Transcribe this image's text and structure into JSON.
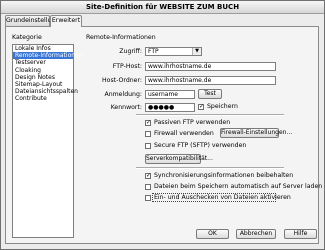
{
  "window": {
    "title": "Site-Definition für WEBSITE ZUM BUCH"
  },
  "tabs": [
    {
      "label": "Grundeinstellungen",
      "active": false
    },
    {
      "label": "Erweitert",
      "active": true
    }
  ],
  "category": {
    "heading": "Kategorie",
    "items": [
      {
        "label": "Lokale Infos",
        "selected": false
      },
      {
        "label": "Remote-Informationen",
        "selected": true
      },
      {
        "label": "Testserver",
        "selected": false
      },
      {
        "label": "Cloaking",
        "selected": false
      },
      {
        "label": "Design Notes",
        "selected": false
      },
      {
        "label": "Sitemap-Layout",
        "selected": false
      },
      {
        "label": "Dateiansichtsspalten",
        "selected": false
      },
      {
        "label": "Contribute",
        "selected": false
      }
    ]
  },
  "remote": {
    "heading": "Remote-Informationen",
    "access_label": "Zugriff:",
    "access_value": "FTP",
    "ftp_host_label": "FTP-Host:",
    "ftp_host_value": "www.ihrhostname.de",
    "host_folder_label": "Host-Ordner:",
    "host_folder_value": "www.ihrhostname.de",
    "login_label": "Anmeldung:",
    "login_value": "username",
    "test_button": "Test",
    "password_label": "Kennwort:",
    "password_value": "●●●●●",
    "save_label": "Speichern",
    "save_checked": true,
    "passive_ftp_label": "Passiven FTP verwenden",
    "passive_ftp_checked": true,
    "firewall_label": "Firewall verwenden",
    "firewall_checked": false,
    "firewall_settings_button": "Firewall-Einstellungen...",
    "secure_ftp_label": "Secure FTP (SFTP) verwenden",
    "secure_ftp_checked": false,
    "server_compat_button": "Serverkompatibilität...",
    "sync_label": "Synchronisierungsinformationen beibehalten",
    "sync_checked": true,
    "autoupload_label": "Dateien beim Speichern automatisch auf Server laden",
    "autoupload_checked": false,
    "checkinout_label": "Ein- und Auschecken von Dateien aktivieren",
    "checkinout_checked": false
  },
  "footer": {
    "ok_button": "OK",
    "cancel_button": "Abbrechen",
    "help_button": "Hilfe"
  }
}
